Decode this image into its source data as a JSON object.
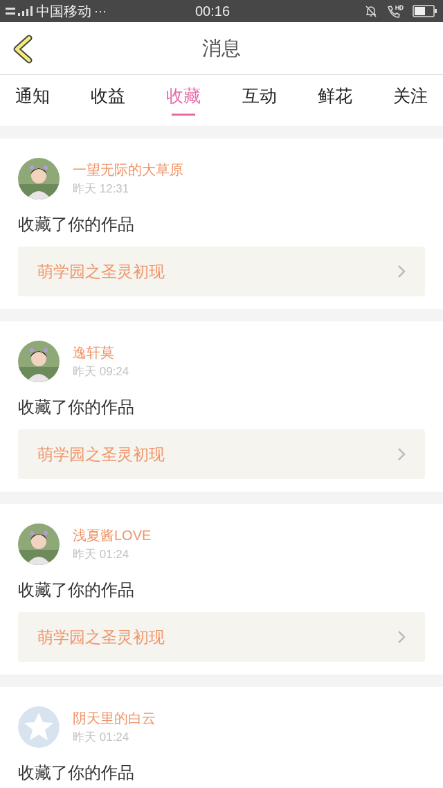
{
  "status_bar": {
    "carrier": "中国移动",
    "more": "···",
    "time": "00:16"
  },
  "header": {
    "title": "消息"
  },
  "tabs": [
    {
      "label": "通知",
      "selected": false
    },
    {
      "label": "收益",
      "selected": false
    },
    {
      "label": "收藏",
      "selected": true
    },
    {
      "label": "互动",
      "selected": false
    },
    {
      "label": "鲜花",
      "selected": false
    },
    {
      "label": "关注",
      "selected": false
    }
  ],
  "messages": [
    {
      "kind": "picture",
      "user": "一望无际的大草原",
      "time": "昨天 12:31",
      "text": "收藏了你的作品",
      "work": "萌学园之圣灵初现"
    },
    {
      "kind": "picture",
      "user": "逸轩莫",
      "time": "昨天 09:24",
      "text": "收藏了你的作品",
      "work": "萌学园之圣灵初现"
    },
    {
      "kind": "picture",
      "user": "浅夏酱LOVE",
      "time": "昨天 01:24",
      "text": "收藏了你的作品",
      "work": "萌学园之圣灵初现"
    },
    {
      "kind": "icon",
      "user": "阴天里的白云",
      "time": "昨天 01:24",
      "text": "收藏了你的作品"
    }
  ]
}
